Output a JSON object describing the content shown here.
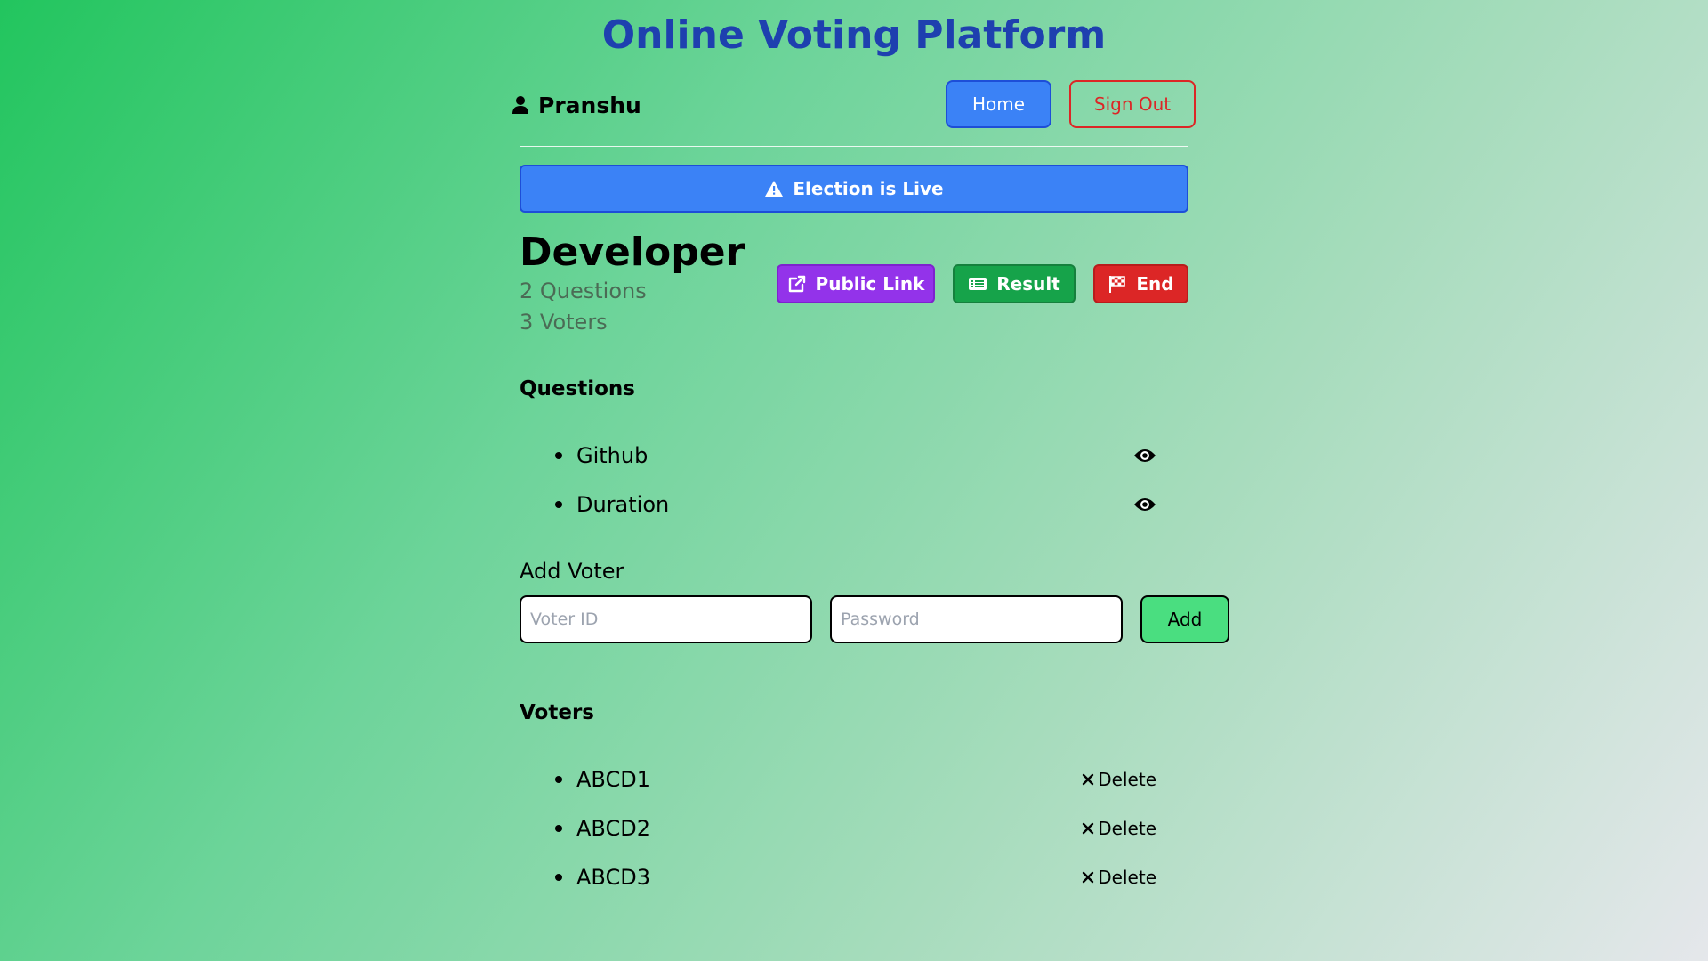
{
  "app": {
    "title": "Online Voting Platform"
  },
  "header": {
    "user_name": "Pranshu",
    "home_label": "Home",
    "signout_label": "Sign Out"
  },
  "banner": {
    "text": "Election is Live"
  },
  "election": {
    "name": "Developer",
    "questions_count": "2 Questions",
    "voters_count": "3 Voters"
  },
  "actions": {
    "public_link_label": "Public Link",
    "result_label": "Result",
    "end_label": "End"
  },
  "questions": {
    "heading": "Questions",
    "items": [
      {
        "label": "Github"
      },
      {
        "label": "Duration"
      }
    ]
  },
  "add_voter": {
    "heading": "Add Voter",
    "voter_id_placeholder": "Voter ID",
    "password_placeholder": "Password",
    "add_label": "Add"
  },
  "voters": {
    "heading": "Voters",
    "delete_label": "Delete",
    "items": [
      {
        "label": "ABCD1"
      },
      {
        "label": "ABCD2"
      },
      {
        "label": "ABCD3"
      }
    ]
  },
  "colors": {
    "title": "#1e40af",
    "primary": "#3b82f6",
    "danger": "#dc2626",
    "success": "#16a34a",
    "purple": "#9333ea",
    "add_button": "#4ade80"
  },
  "icons": {
    "user": "user-icon",
    "warning": "warning-icon",
    "external_link": "external-link-icon",
    "result": "list-icon",
    "end": "flag-checkered-icon",
    "view": "eye-icon",
    "delete": "close-icon"
  }
}
